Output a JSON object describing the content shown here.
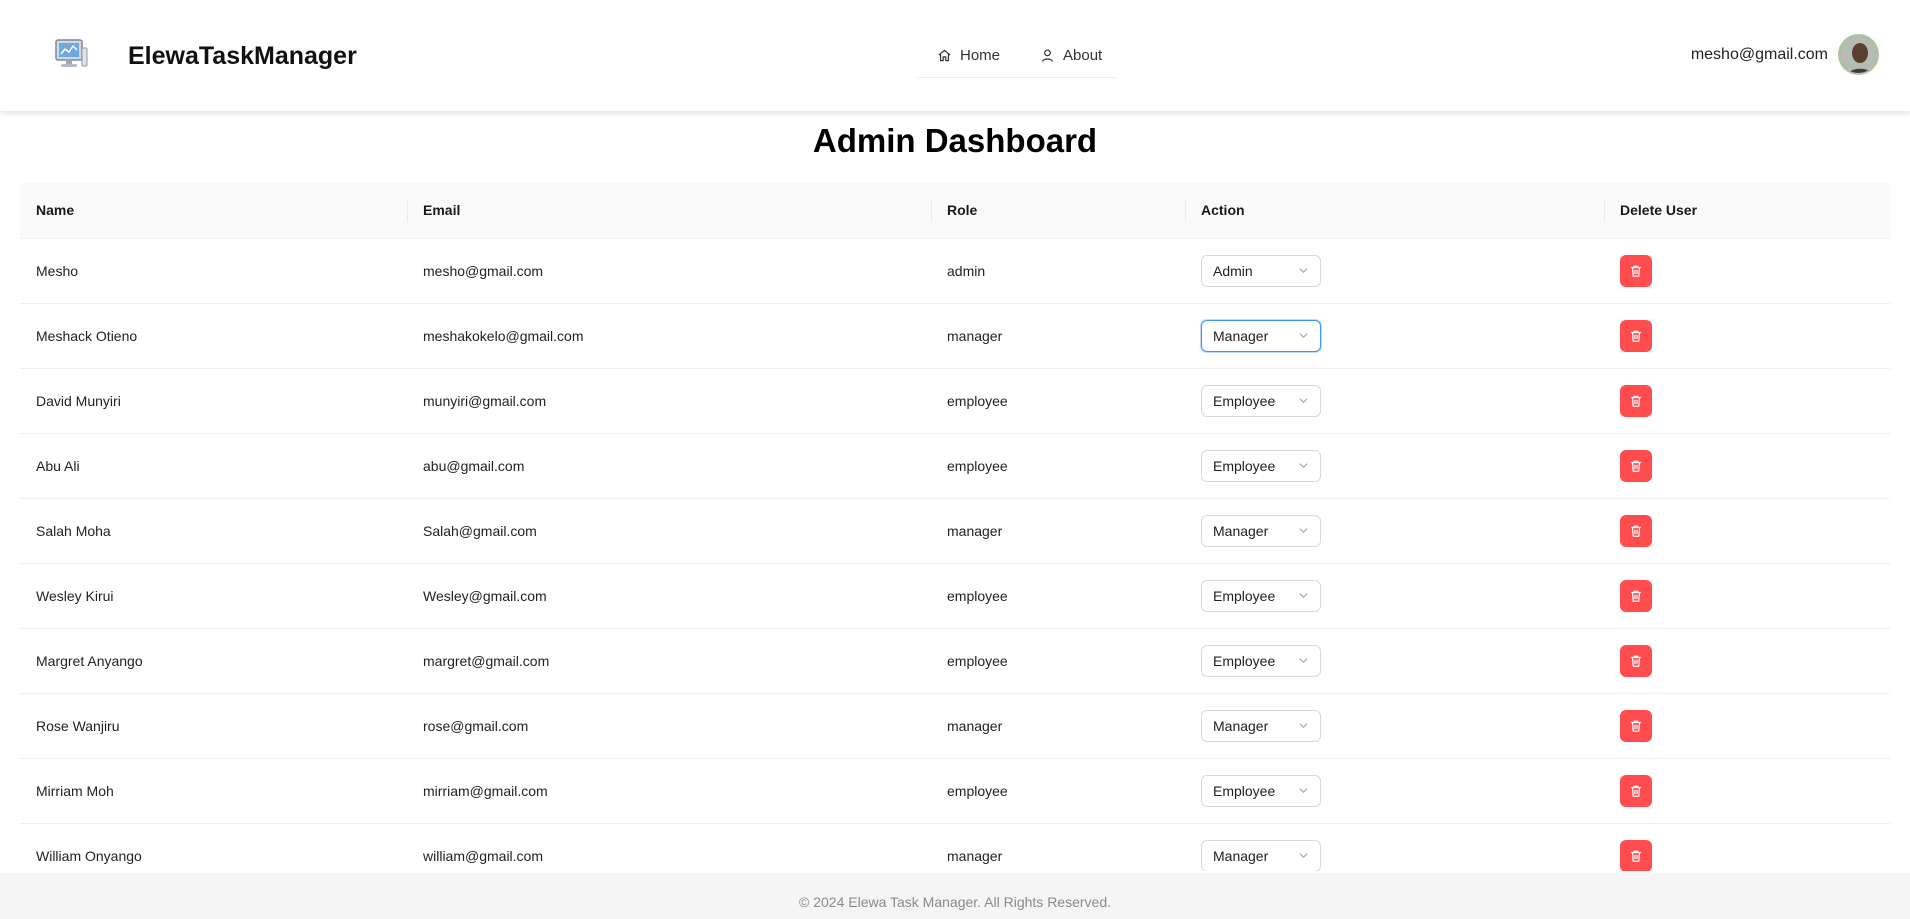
{
  "header": {
    "brand": "ElewaTaskManager",
    "logo_icon": "computer-monitor-icon",
    "nav": [
      {
        "label": "Home",
        "icon": "home-icon"
      },
      {
        "label": "About",
        "icon": "user-icon"
      }
    ],
    "user_email": "mesho@gmail.com"
  },
  "page_title": "Admin Dashboard",
  "table": {
    "columns": [
      "Name",
      "Email",
      "Role",
      "Action",
      "Delete User"
    ],
    "rows": [
      {
        "name": "Mesho",
        "email": "mesho@gmail.com",
        "role": "admin",
        "action": "Admin"
      },
      {
        "name": "Meshack Otieno",
        "email": "meshakokelo@gmail.com",
        "role": "manager",
        "action": "Manager"
      },
      {
        "name": "David Munyiri",
        "email": "munyiri@gmail.com",
        "role": "employee",
        "action": "Employee"
      },
      {
        "name": "Abu Ali",
        "email": "abu@gmail.com",
        "role": "employee",
        "action": "Employee"
      },
      {
        "name": "Salah Moha",
        "email": "Salah@gmail.com",
        "role": "manager",
        "action": "Manager"
      },
      {
        "name": "Wesley Kirui",
        "email": "Wesley@gmail.com",
        "role": "employee",
        "action": "Employee"
      },
      {
        "name": "Margret Anyango",
        "email": "margret@gmail.com",
        "role": "employee",
        "action": "Employee"
      },
      {
        "name": "Rose Wanjiru",
        "email": "rose@gmail.com",
        "role": "manager",
        "action": "Manager"
      },
      {
        "name": "Mirriam Moh",
        "email": "mirriam@gmail.com",
        "role": "employee",
        "action": "Employee"
      },
      {
        "name": "William Onyango",
        "email": "william@gmail.com",
        "role": "manager",
        "action": "Manager"
      }
    ],
    "focused_select_row": 1
  },
  "colors": {
    "delete_button": "#ff4d4f",
    "focus_border": "#4096ff"
  },
  "footer": {
    "text": "© 2024 Elewa Task Manager. All Rights Reserved."
  }
}
